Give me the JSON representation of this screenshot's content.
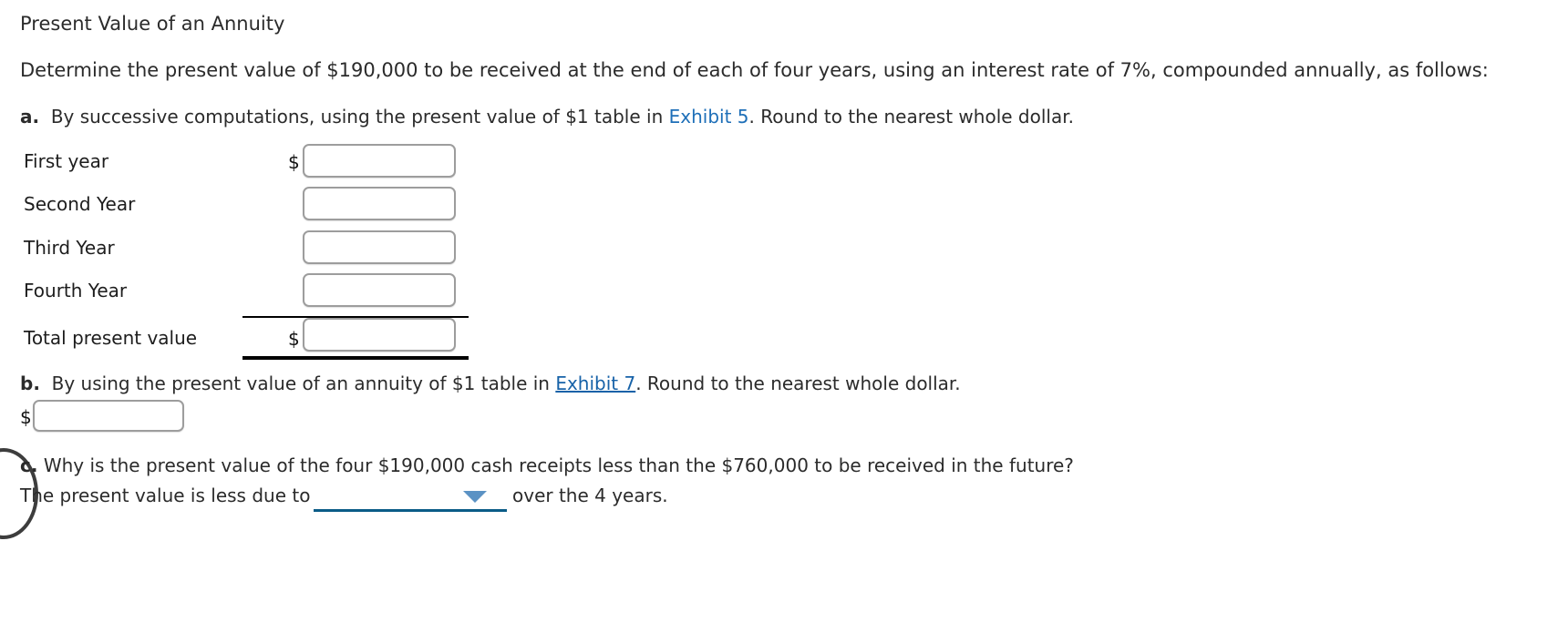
{
  "title": "Present Value of an Annuity",
  "intro": {
    "text": "Determine the present value of $190,000 to be received at the end of each of four years, using an interest rate of 7%, compounded annually, as follows:",
    "amount": "$190,000",
    "rate": "7%",
    "years": "four"
  },
  "parts": {
    "a": {
      "marker": "a.",
      "text_before_link": "By successive computations, using the present value of $1 table in ",
      "link_label": "Exhibit 5",
      "text_after_link": ". Round to the nearest whole dollar.",
      "rows": [
        {
          "label": "First year",
          "dollar_sign": "$",
          "value": "",
          "placeholder": ""
        },
        {
          "label": "Second Year",
          "dollar_sign": "",
          "value": "",
          "placeholder": ""
        },
        {
          "label": "Third Year",
          "dollar_sign": "",
          "value": "",
          "placeholder": ""
        },
        {
          "label": "Fourth Year",
          "dollar_sign": "",
          "value": "",
          "placeholder": ""
        },
        {
          "label": "Total present value",
          "dollar_sign": "$",
          "value": "",
          "placeholder": ""
        }
      ]
    },
    "b": {
      "marker": "b.",
      "text_before_link": "By using the present value of an annuity of $1 table in ",
      "link_label": "Exhibit 7",
      "text_after_link": ". Round to the nearest whole dollar.",
      "dollar_sign": "$",
      "value": "",
      "placeholder": ""
    },
    "c": {
      "marker": "c.",
      "question": "Why is the present value of the four $190,000 cash receipts less than the $760,000 to be received in the future?",
      "answer_prefix": "The present value is less due to",
      "dropdown_value": "",
      "answer_suffix": "over the 4 years."
    }
  },
  "colors": {
    "link_blue": "#1e6fb8",
    "link_blue_underlined": "#1762a8",
    "caret_blue": "#5b92c4",
    "dropdown_underline": "#0a5c87",
    "input_border": "#9d9d9d",
    "text": "#2b2b2b"
  }
}
